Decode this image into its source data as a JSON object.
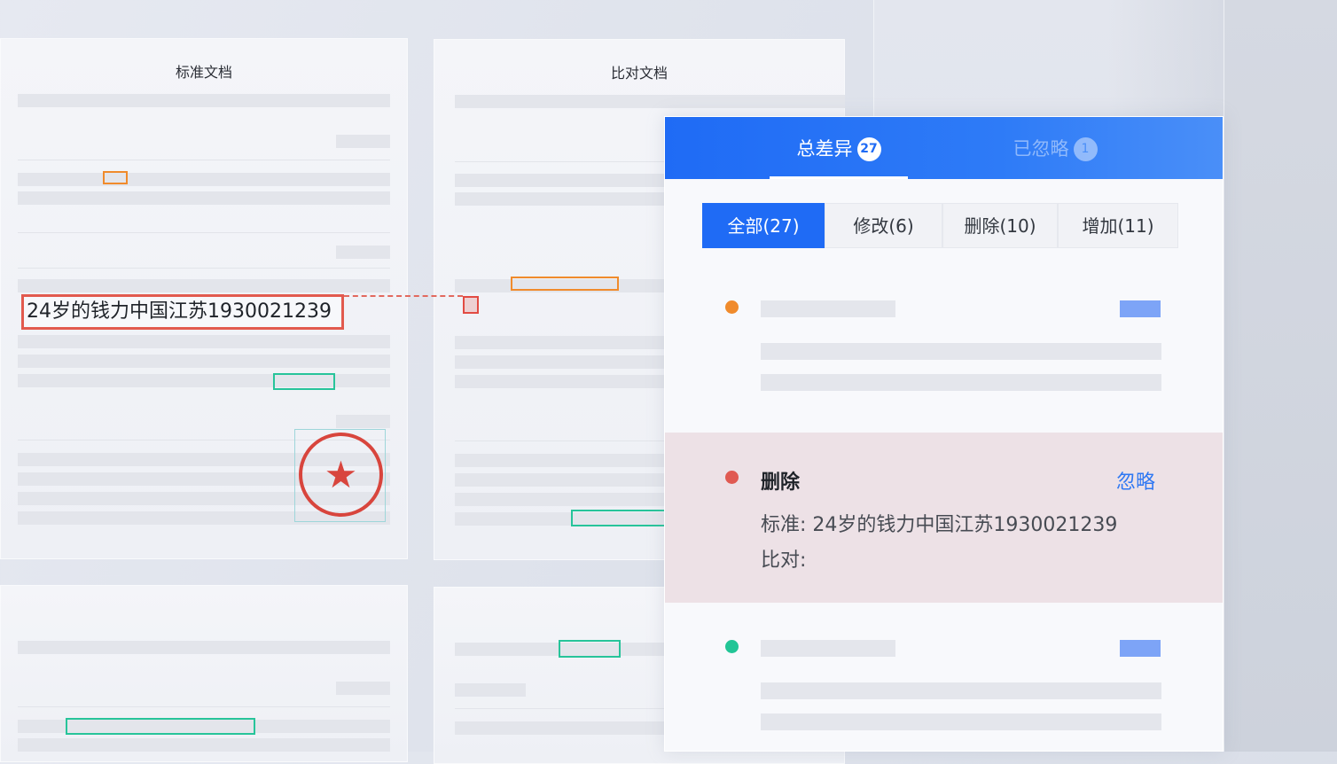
{
  "documents": {
    "standard": {
      "title": "标准文档"
    },
    "compare": {
      "title": "比对文档"
    }
  },
  "highlight": {
    "text": "24岁的钱力中国江苏1930021239"
  },
  "panel": {
    "tabs": [
      {
        "label": "总差异",
        "count": "27",
        "active": true
      },
      {
        "label": "已忽略",
        "count": "1",
        "active": false
      }
    ],
    "filters": [
      {
        "label": "全部(27)",
        "active": true
      },
      {
        "label": "修改(6)",
        "active": false
      },
      {
        "label": "删除(10)",
        "active": false
      },
      {
        "label": "增加(11)",
        "active": false
      }
    ],
    "items": [
      {
        "type": "modify",
        "color": "#f08b2c"
      },
      {
        "type": "delete",
        "color": "#e05a52",
        "title": "删除",
        "action": "忽略",
        "standard_label": "标准:",
        "standard_value": "24岁的钱力中国江苏1930021239",
        "compare_label": "比对:"
      },
      {
        "type": "add",
        "color": "#22c596"
      }
    ]
  },
  "colors": {
    "accent": "#1f6bf5",
    "modify": "#f08b2c",
    "delete": "#e24b43",
    "add": "#27c49a",
    "tag": "#7da4f7"
  },
  "icons": {
    "stamp": "seal-star-icon"
  }
}
